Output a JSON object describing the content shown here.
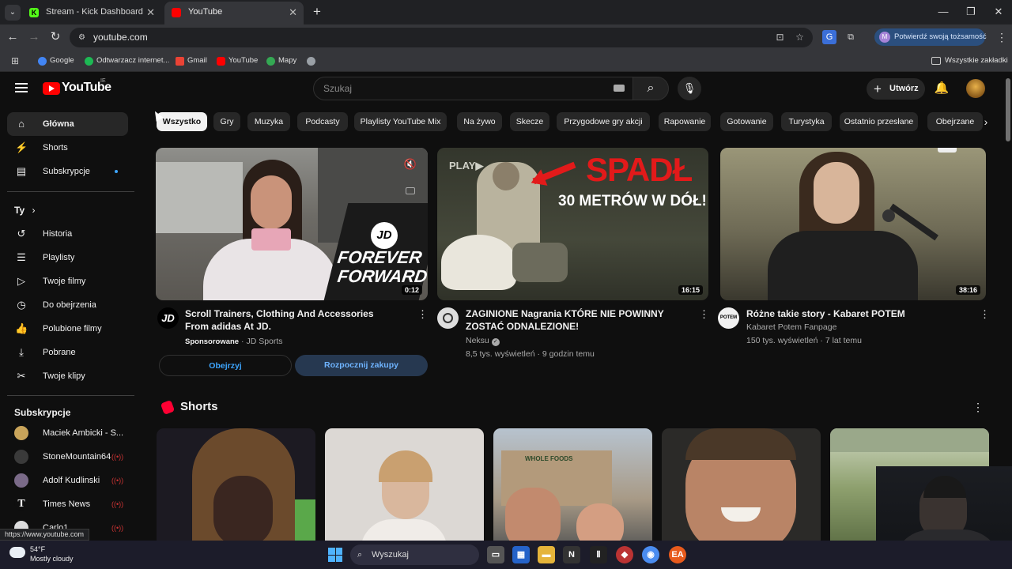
{
  "browser": {
    "tabs": [
      {
        "title": "Stream - Kick Dashboard",
        "favicon_color": "#53fc18",
        "favicon_letter": "K"
      },
      {
        "title": "YouTube",
        "favicon_color": "#ff0000"
      }
    ],
    "url": "youtube.com",
    "profile_prompt": "Potwierdź swoją tożsamość",
    "profile_initial": "M",
    "bookmarks": [
      {
        "label": "Google",
        "icon": "google-icon",
        "color": "#4285f4"
      },
      {
        "label": "Odtwarzacz internet...",
        "icon": "spotify-icon",
        "color": "#1db954"
      },
      {
        "label": "Gmail",
        "icon": "gmail-icon",
        "color": "#ea4335"
      },
      {
        "label": "YouTube",
        "icon": "youtube-icon",
        "color": "#ff0000"
      },
      {
        "label": "Mapy",
        "icon": "maps-icon",
        "color": "#34a853"
      },
      {
        "label": "",
        "icon": "globe-icon",
        "color": "#9aa0a6"
      }
    ],
    "all_bookmarks": "Wszystkie zakładki",
    "status_url": "https://www.youtube.com"
  },
  "yt": {
    "logo": "YouTube",
    "country": "IE",
    "search_placeholder": "Szukaj",
    "create_label": "Utwórz",
    "sidebar": {
      "main": [
        {
          "label": "Główna",
          "icon": "home-icon",
          "active": true
        },
        {
          "label": "Shorts",
          "icon": "shorts-icon"
        },
        {
          "label": "Subskrypcje",
          "icon": "subscriptions-icon",
          "dot": true
        }
      ],
      "you_heading": "Ty",
      "you": [
        {
          "label": "Historia",
          "icon": "history-icon"
        },
        {
          "label": "Playlisty",
          "icon": "playlists-icon"
        },
        {
          "label": "Twoje filmy",
          "icon": "your-videos-icon"
        },
        {
          "label": "Do obejrzenia",
          "icon": "watch-later-icon"
        },
        {
          "label": "Polubione filmy",
          "icon": "liked-icon"
        },
        {
          "label": "Pobrane",
          "icon": "downloads-icon"
        },
        {
          "label": "Twoje klipy",
          "icon": "clips-icon"
        }
      ],
      "subs_heading": "Subskrypcje",
      "subs": [
        {
          "label": "Maciek Ambicki - S...",
          "live": false,
          "color": "#c9a45a"
        },
        {
          "label": "StoneMountain64",
          "live": true,
          "color": "#444"
        },
        {
          "label": "Adolf Kudlinski",
          "live": true,
          "color": "#7a6a88"
        },
        {
          "label": "Times News",
          "live": true,
          "color": "#222"
        },
        {
          "label": "Carlo1",
          "live": true,
          "color": "#ddd"
        }
      ]
    },
    "chips": [
      "Wszystko",
      "Gry",
      "Muzyka",
      "Podcasty",
      "Playlisty YouTube Mix",
      "Na żywo",
      "Skecze",
      "Przygodowe gry akcji",
      "Rapowanie",
      "Gotowanie",
      "Turystyka",
      "Ostatnio przesłane",
      "Obejrzane"
    ],
    "videos": [
      {
        "title": "Scroll Trainers, Clothing And Accessories From adidas At JD.",
        "sponsored": "Sponsorowane",
        "channel": "JD Sports",
        "duration": "0:12",
        "thumb_text_1": "JD",
        "thumb_text_2": "FOREVER",
        "thumb_text_3": "FORWARD",
        "btn_watch": "Obejrzyj",
        "btn_shop": "Rozpocznij zakupy"
      },
      {
        "title": "ZAGINIONE Nagrania KTÓRE NIE POWINNY ZOSTAĆ ODNALEZIONE!",
        "channel": "Neksu",
        "verified": true,
        "views": "8,5 tys. wyświetleń",
        "age": "9 godzin temu",
        "duration": "16:15",
        "thumb_play": "PLAY▶",
        "thumb_headline": "SPADŁ",
        "thumb_sub": "30 METRÓW W DÓŁ!"
      },
      {
        "title": "Różne takie story - Kabaret POTEM",
        "channel": "Kabaret Potem Fanpage",
        "views": "150 tys. wyświetleń",
        "age": "7 lat temu",
        "duration": "38:16"
      }
    ],
    "shorts_heading": "Shorts"
  },
  "taskbar": {
    "temp": "54°F",
    "weather": "Mostly cloudy",
    "search": "Wyszukaj"
  }
}
